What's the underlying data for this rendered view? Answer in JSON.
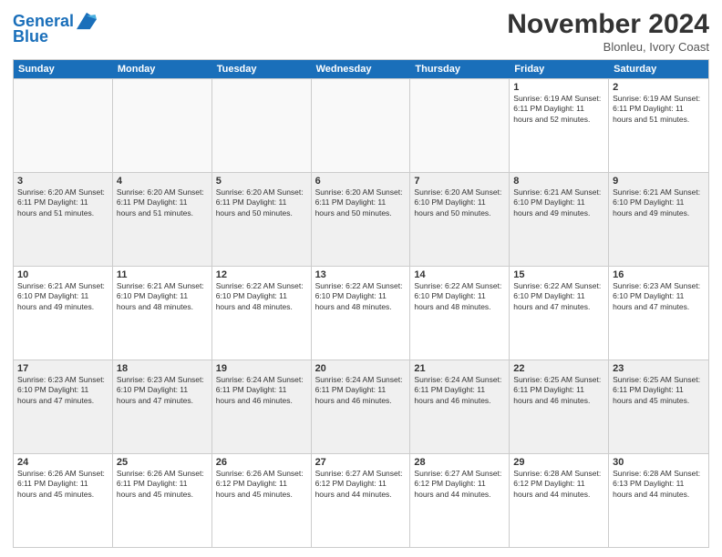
{
  "logo": {
    "line1": "General",
    "line2": "Blue"
  },
  "title": "November 2024",
  "location": "Blonleu, Ivory Coast",
  "header": {
    "days": [
      "Sunday",
      "Monday",
      "Tuesday",
      "Wednesday",
      "Thursday",
      "Friday",
      "Saturday"
    ]
  },
  "weeks": [
    [
      {
        "day": "",
        "detail": "",
        "empty": true
      },
      {
        "day": "",
        "detail": "",
        "empty": true
      },
      {
        "day": "",
        "detail": "",
        "empty": true
      },
      {
        "day": "",
        "detail": "",
        "empty": true
      },
      {
        "day": "",
        "detail": "",
        "empty": true
      },
      {
        "day": "1",
        "detail": "Sunrise: 6:19 AM\nSunset: 6:11 PM\nDaylight: 11 hours\nand 52 minutes.",
        "empty": false
      },
      {
        "day": "2",
        "detail": "Sunrise: 6:19 AM\nSunset: 6:11 PM\nDaylight: 11 hours\nand 51 minutes.",
        "empty": false
      }
    ],
    [
      {
        "day": "3",
        "detail": "Sunrise: 6:20 AM\nSunset: 6:11 PM\nDaylight: 11 hours\nand 51 minutes.",
        "empty": false
      },
      {
        "day": "4",
        "detail": "Sunrise: 6:20 AM\nSunset: 6:11 PM\nDaylight: 11 hours\nand 51 minutes.",
        "empty": false
      },
      {
        "day": "5",
        "detail": "Sunrise: 6:20 AM\nSunset: 6:11 PM\nDaylight: 11 hours\nand 50 minutes.",
        "empty": false
      },
      {
        "day": "6",
        "detail": "Sunrise: 6:20 AM\nSunset: 6:11 PM\nDaylight: 11 hours\nand 50 minutes.",
        "empty": false
      },
      {
        "day": "7",
        "detail": "Sunrise: 6:20 AM\nSunset: 6:10 PM\nDaylight: 11 hours\nand 50 minutes.",
        "empty": false
      },
      {
        "day": "8",
        "detail": "Sunrise: 6:21 AM\nSunset: 6:10 PM\nDaylight: 11 hours\nand 49 minutes.",
        "empty": false
      },
      {
        "day": "9",
        "detail": "Sunrise: 6:21 AM\nSunset: 6:10 PM\nDaylight: 11 hours\nand 49 minutes.",
        "empty": false
      }
    ],
    [
      {
        "day": "10",
        "detail": "Sunrise: 6:21 AM\nSunset: 6:10 PM\nDaylight: 11 hours\nand 49 minutes.",
        "empty": false
      },
      {
        "day": "11",
        "detail": "Sunrise: 6:21 AM\nSunset: 6:10 PM\nDaylight: 11 hours\nand 48 minutes.",
        "empty": false
      },
      {
        "day": "12",
        "detail": "Sunrise: 6:22 AM\nSunset: 6:10 PM\nDaylight: 11 hours\nand 48 minutes.",
        "empty": false
      },
      {
        "day": "13",
        "detail": "Sunrise: 6:22 AM\nSunset: 6:10 PM\nDaylight: 11 hours\nand 48 minutes.",
        "empty": false
      },
      {
        "day": "14",
        "detail": "Sunrise: 6:22 AM\nSunset: 6:10 PM\nDaylight: 11 hours\nand 48 minutes.",
        "empty": false
      },
      {
        "day": "15",
        "detail": "Sunrise: 6:22 AM\nSunset: 6:10 PM\nDaylight: 11 hours\nand 47 minutes.",
        "empty": false
      },
      {
        "day": "16",
        "detail": "Sunrise: 6:23 AM\nSunset: 6:10 PM\nDaylight: 11 hours\nand 47 minutes.",
        "empty": false
      }
    ],
    [
      {
        "day": "17",
        "detail": "Sunrise: 6:23 AM\nSunset: 6:10 PM\nDaylight: 11 hours\nand 47 minutes.",
        "empty": false
      },
      {
        "day": "18",
        "detail": "Sunrise: 6:23 AM\nSunset: 6:10 PM\nDaylight: 11 hours\nand 47 minutes.",
        "empty": false
      },
      {
        "day": "19",
        "detail": "Sunrise: 6:24 AM\nSunset: 6:11 PM\nDaylight: 11 hours\nand 46 minutes.",
        "empty": false
      },
      {
        "day": "20",
        "detail": "Sunrise: 6:24 AM\nSunset: 6:11 PM\nDaylight: 11 hours\nand 46 minutes.",
        "empty": false
      },
      {
        "day": "21",
        "detail": "Sunrise: 6:24 AM\nSunset: 6:11 PM\nDaylight: 11 hours\nand 46 minutes.",
        "empty": false
      },
      {
        "day": "22",
        "detail": "Sunrise: 6:25 AM\nSunset: 6:11 PM\nDaylight: 11 hours\nand 46 minutes.",
        "empty": false
      },
      {
        "day": "23",
        "detail": "Sunrise: 6:25 AM\nSunset: 6:11 PM\nDaylight: 11 hours\nand 45 minutes.",
        "empty": false
      }
    ],
    [
      {
        "day": "24",
        "detail": "Sunrise: 6:26 AM\nSunset: 6:11 PM\nDaylight: 11 hours\nand 45 minutes.",
        "empty": false
      },
      {
        "day": "25",
        "detail": "Sunrise: 6:26 AM\nSunset: 6:11 PM\nDaylight: 11 hours\nand 45 minutes.",
        "empty": false
      },
      {
        "day": "26",
        "detail": "Sunrise: 6:26 AM\nSunset: 6:12 PM\nDaylight: 11 hours\nand 45 minutes.",
        "empty": false
      },
      {
        "day": "27",
        "detail": "Sunrise: 6:27 AM\nSunset: 6:12 PM\nDaylight: 11 hours\nand 44 minutes.",
        "empty": false
      },
      {
        "day": "28",
        "detail": "Sunrise: 6:27 AM\nSunset: 6:12 PM\nDaylight: 11 hours\nand 44 minutes.",
        "empty": false
      },
      {
        "day": "29",
        "detail": "Sunrise: 6:28 AM\nSunset: 6:12 PM\nDaylight: 11 hours\nand 44 minutes.",
        "empty": false
      },
      {
        "day": "30",
        "detail": "Sunrise: 6:28 AM\nSunset: 6:13 PM\nDaylight: 11 hours\nand 44 minutes.",
        "empty": false
      }
    ]
  ]
}
